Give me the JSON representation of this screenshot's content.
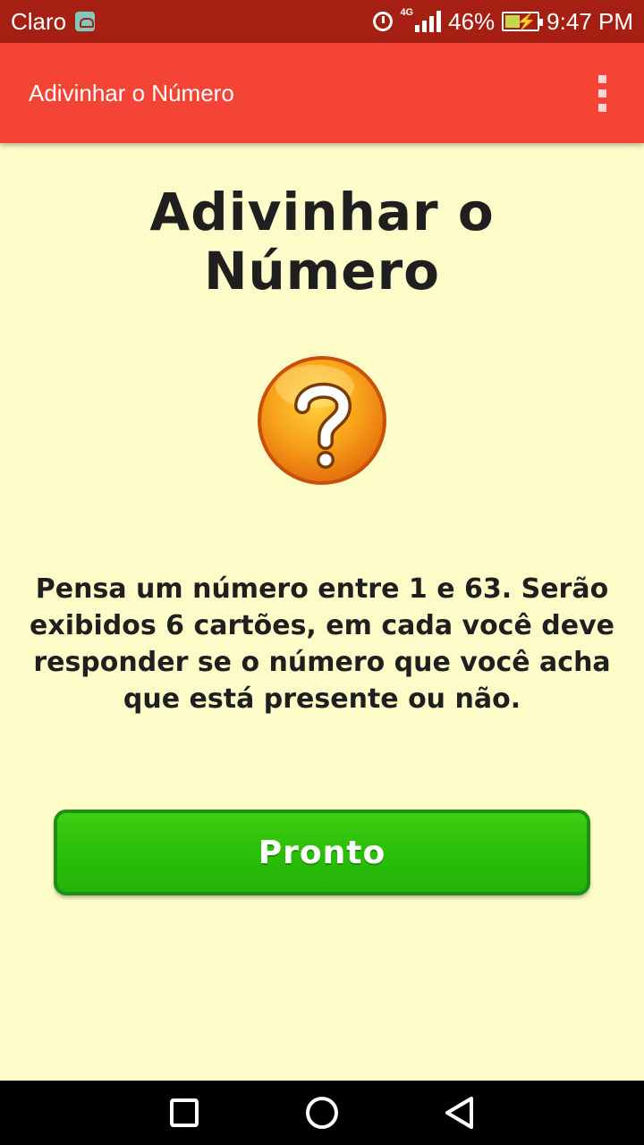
{
  "status_bar": {
    "carrier": "Claro",
    "network": "4G",
    "battery": "46%",
    "time": "9:47 PM"
  },
  "app_bar": {
    "title": "Adivinhar o Número",
    "overflow_icon": "more-vert-icon"
  },
  "main": {
    "title_line1": "Adivinhar o",
    "title_line2": "Número",
    "icon": "question-mark-icon",
    "instructions": "Pensa um número entre 1 e 63. Serão exibidos 6 cartões, em cada você deve responder se o número que você acha que está presente ou não.",
    "button_label": "Pronto"
  },
  "colors": {
    "status_bar": "#a51f12",
    "app_bar": "#f44436",
    "background": "#fdfcc8",
    "button": "#2bc009"
  },
  "nav_bar": {
    "recent_icon": "square-icon",
    "home_icon": "circle-icon",
    "back_icon": "triangle-back-icon"
  }
}
